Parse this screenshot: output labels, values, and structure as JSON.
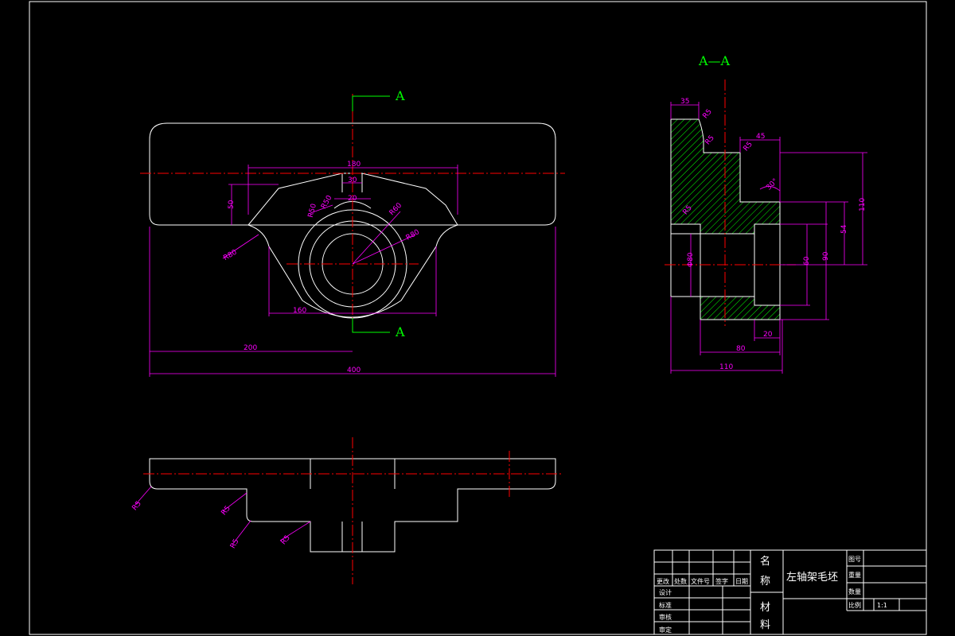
{
  "section_labels": {
    "a_top": "A",
    "a_bottom": "A",
    "section_title": "A—A"
  },
  "front_view_dims": {
    "d180": "180",
    "d30a": "30",
    "d20": "20",
    "d50": "50",
    "r50a": "R50",
    "r50b": "R50",
    "r60": "R60",
    "r80": "R80",
    "r80b": "R80",
    "d160": "160",
    "d200": "200",
    "d400": "400"
  },
  "section_view_dims": {
    "d35": "35",
    "r15a": "R5",
    "r5": "R5",
    "d45": "45",
    "r15b": "R5",
    "ang30": "30°",
    "r5b": "R5",
    "d110v": "110",
    "d54": "54",
    "d90": "90",
    "d60": "60",
    "d80dia": "Φ80",
    "d20": "20",
    "d80": "80",
    "d110h": "110"
  },
  "bottom_view_dims": {
    "r5a": "R5",
    "r5b": "R5",
    "r5c": "R5",
    "r5d": "R5"
  },
  "title_block": {
    "col_headers": [
      "更改",
      "处数",
      "文件号",
      "签字",
      "日期"
    ],
    "row_labels": [
      "设计",
      "标准",
      "审核",
      "审定"
    ],
    "name_label_1": "名",
    "name_label_2": "称",
    "material_label_1": "材",
    "material_label_2": "料",
    "part_name": "左轴架毛坯",
    "drawing_no_label": "图号",
    "weight_label": "重量",
    "qty_label": "数量",
    "scale_label": "比例",
    "scale_value": "1:1"
  },
  "colors": {
    "outline": "#ffffff",
    "centerline": "#ff0000",
    "dimension": "#ff00ff",
    "section_label": "#00ff00",
    "hatch": "#00ff00"
  }
}
